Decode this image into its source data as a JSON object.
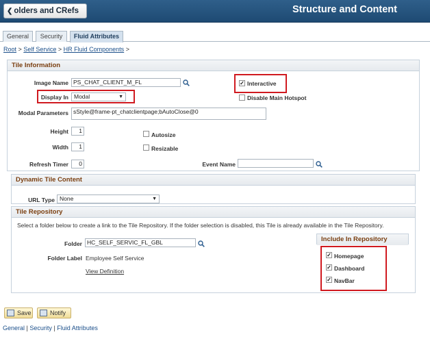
{
  "header": {
    "back_label": "olders and CRefs",
    "title": "Structure and Content"
  },
  "tabs": [
    {
      "label": "General"
    },
    {
      "label": "Security"
    },
    {
      "label": "Fluid Attributes"
    }
  ],
  "breadcrumb": {
    "root": "Root",
    "self_service": "Self Service",
    "hr_fluid": "HR Fluid Components",
    "sep": ">"
  },
  "tile_info": {
    "heading": "Tile Information",
    "image_name_label": "Image Name",
    "image_name_value": "PS_CHAT_CLIENT_M_FL",
    "interactive_label": "Interactive",
    "interactive_checked": true,
    "display_in_label": "Display In",
    "display_in_value": "Modal",
    "disable_hotspot_label": "Disable Main Hotspot",
    "disable_hotspot_checked": false,
    "modal_params_label": "Modal Parameters",
    "modal_params_value": "sStyle@frame-pt_chatclientpage;bAutoClose@0",
    "height_label": "Height",
    "height_value": "1",
    "autosize_label": "Autosize",
    "width_label": "Width",
    "width_value": "1",
    "resizable_label": "Resizable",
    "refresh_label": "Refresh Timer",
    "refresh_value": "0",
    "event_name_label": "Event Name",
    "event_name_value": ""
  },
  "dynamic": {
    "heading": "Dynamic Tile Content",
    "url_type_label": "URL Type",
    "url_type_value": "None"
  },
  "repository": {
    "heading": "Tile Repository",
    "description": "Select a folder below to create a link to the Tile Repository. If the folder selection is disabled, this Tile is already available in the Tile Repository.",
    "folder_label": "Folder",
    "folder_value": "HC_SELF_SERVIC_FL_GBL",
    "folder_label_label": "Folder Label",
    "folder_label_value": "Employee Self Service",
    "view_definition": "View Definition",
    "include_heading": "Include In Repository",
    "include_items": [
      {
        "label": "Homepage",
        "checked": true
      },
      {
        "label": "Dashboard",
        "checked": true
      },
      {
        "label": "NavBar",
        "checked": true
      }
    ]
  },
  "footer": {
    "save_label": "Save",
    "notify_label": "Notify",
    "links": [
      "General",
      "Security",
      "Fluid Attributes"
    ],
    "link_sep": "|"
  },
  "colors": {
    "header_bg": "#1e4a73",
    "highlight_red": "#d0191f",
    "link": "#1b4f8a",
    "group_heading": "#7a3e0f"
  }
}
